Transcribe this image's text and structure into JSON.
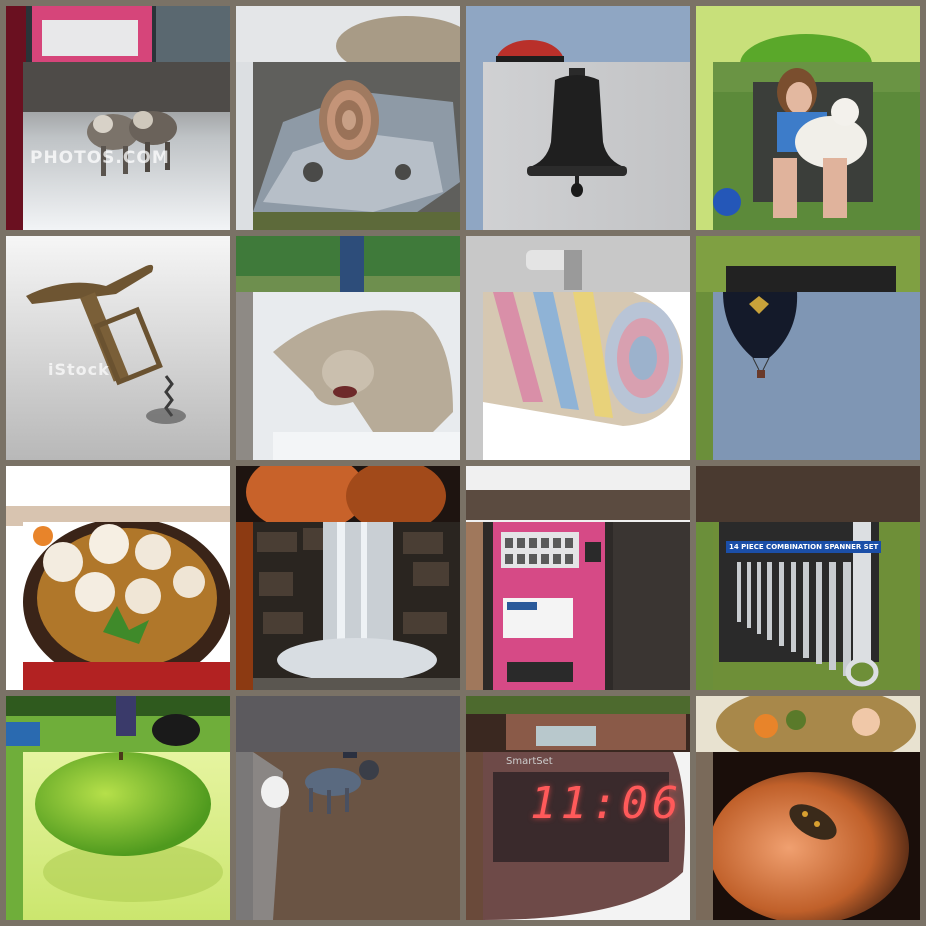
{
  "collage": {
    "watermarks": {
      "photos_com": "PHOTOS.COM",
      "istock": "iStock"
    },
    "clock": {
      "brand": "SmartSet",
      "time": "11:06"
    },
    "wrench_set": {
      "label": "14 PIECE COMBINATION SPANNER SET"
    },
    "tiles": [
      {
        "row": 1,
        "col": 1,
        "front": "wolves-in-snow",
        "back": "vending-machine"
      },
      {
        "row": 1,
        "col": 2,
        "front": "coiled-snake-on-rock",
        "back": "snow-and-fur"
      },
      {
        "row": 1,
        "col": 3,
        "front": "black-bell",
        "back": "hot-air-balloon"
      },
      {
        "row": 1,
        "col": 4,
        "front": "girl-with-dog",
        "back": "green-apple"
      },
      {
        "row": 2,
        "col": 1,
        "front": "antique-corkscrew",
        "back": "antique-corkscrew"
      },
      {
        "row": 2,
        "col": 2,
        "front": "wolf-eating-in-snow",
        "back": "person-in-park"
      },
      {
        "row": 2,
        "col": 3,
        "front": "rolled-blanket",
        "back": "wall-fixture"
      },
      {
        "row": 2,
        "col": 4,
        "front": "black-hot-air-balloon",
        "back": "wrench-set-on-grass"
      },
      {
        "row": 3,
        "col": 1,
        "front": "scallops-in-bowl",
        "back": "striped-fabric"
      },
      {
        "row": 3,
        "col": 2,
        "front": "waterfall",
        "back": "hands-holding"
      },
      {
        "row": 3,
        "col": 3,
        "front": "pink-vending-machine",
        "back": "vending-machine-outdoor"
      },
      {
        "row": 3,
        "col": 4,
        "front": "wrench-set",
        "back": "dark-rock"
      },
      {
        "row": 4,
        "col": 1,
        "front": "green-apple",
        "back": "dogs-on-grass"
      },
      {
        "row": 4,
        "col": 2,
        "front": "dogs-on-dirt",
        "back": "rock-surface"
      },
      {
        "row": 4,
        "col": 3,
        "front": "alarm-clock",
        "back": "waterfall-steps"
      },
      {
        "row": 4,
        "col": 4,
        "front": "hands-with-lizard",
        "back": "food-bowl"
      }
    ]
  }
}
